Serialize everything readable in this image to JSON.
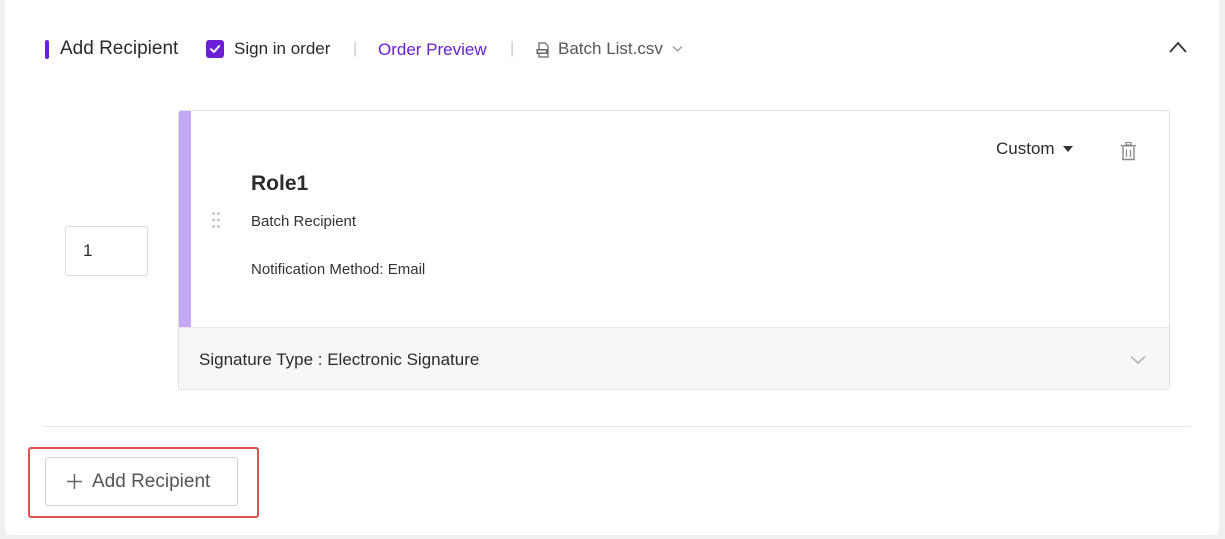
{
  "header": {
    "title": "Add Recipient",
    "sign_in_order_label": "Sign in order",
    "sign_in_order_checked": true,
    "separator": "|",
    "order_preview_label": "Order Preview",
    "batch_file_label": "Batch List.csv"
  },
  "recipients": [
    {
      "order": "1",
      "role_name": "Role1",
      "type": "Batch Recipient",
      "notification": "Notification Method: Email",
      "permission_label": "Custom",
      "signature_type": "Signature Type : Electronic Signature"
    }
  ],
  "actions": {
    "add_recipient_label": "Add Recipient"
  },
  "colors": {
    "accent": "#6a1fd6",
    "card_stripe": "#c4a6f7",
    "highlight_border": "#e05050"
  },
  "icons": [
    "checkbox-checked-icon",
    "csv-file-icon",
    "chevron-down-icon",
    "chevron-up-icon",
    "drag-handle-icon",
    "caret-down-icon",
    "trash-icon",
    "plus-icon"
  ]
}
